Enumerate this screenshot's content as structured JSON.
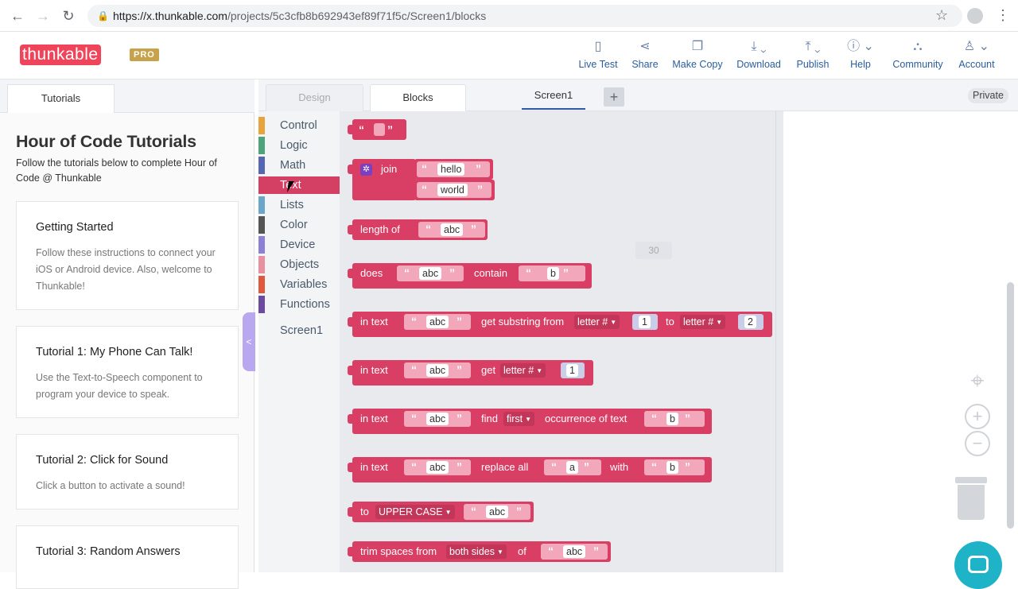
{
  "browser": {
    "url_host": "https://x.thunkable.com",
    "url_path": "/projects/5c3cfb8b692943ef89f71f5c/Screen1/blocks"
  },
  "header": {
    "logo": "thunkable",
    "pro": "PRO",
    "buttons": [
      {
        "label": "Live Test",
        "icon": "phone-icon"
      },
      {
        "label": "Share",
        "icon": "share-icon"
      },
      {
        "label": "Make Copy",
        "icon": "copy-icon"
      },
      {
        "label": "Download",
        "icon": "download-icon"
      },
      {
        "label": "Publish",
        "icon": "publish-icon"
      },
      {
        "label": "Help",
        "icon": "help-icon"
      },
      {
        "label": "Community",
        "icon": "community-icon"
      },
      {
        "label": "Account",
        "icon": "account-icon"
      }
    ]
  },
  "left": {
    "tab": "Tutorials",
    "title": "Hour of Code Tutorials",
    "subtitle": "Follow the tutorials below to complete Hour of Code @ Thunkable",
    "cards": [
      {
        "title": "Getting Started",
        "desc": "Follow these instructions to connect your iOS or Android device. Also, welcome to Thunkable!"
      },
      {
        "title": "Tutorial 1: My Phone Can Talk!",
        "desc": "Use the Text-to-Speech component to program your device to speak."
      },
      {
        "title": "Tutorial 2: Click for Sound",
        "desc": "Click a button to activate a sound!"
      },
      {
        "title": "Tutorial 3: Random Answers",
        "desc": ""
      }
    ]
  },
  "editor": {
    "tabs": {
      "design": "Design",
      "blocks": "Blocks",
      "screen": "Screen1",
      "add": "+",
      "private": "Private"
    },
    "categories": [
      {
        "name": "Control",
        "color": "#e8a33d"
      },
      {
        "name": "Logic",
        "color": "#4fa37a"
      },
      {
        "name": "Math",
        "color": "#5566b3"
      },
      {
        "name": "Text",
        "color": "#d43f64"
      },
      {
        "name": "Lists",
        "color": "#6aa6c7"
      },
      {
        "name": "Color",
        "color": "#555555"
      },
      {
        "name": "Device",
        "color": "#8c7fd6"
      },
      {
        "name": "Objects",
        "color": "#e88fa0"
      },
      {
        "name": "Variables",
        "color": "#e2583e"
      },
      {
        "name": "Functions",
        "color": "#6c4aa0"
      },
      {
        "name": "Screen1",
        "color": ""
      }
    ],
    "ghost_value": "30",
    "blocks": {
      "join": "join",
      "hello": "hello",
      "world": "world",
      "length_of": "length of",
      "abc": "abc",
      "does": "does",
      "contain": "contain",
      "b": "b",
      "in_text": "in text",
      "get_substring_from": "get substring from",
      "letter_num": "letter #",
      "one": "1",
      "two": "2",
      "to": "to",
      "get": "get",
      "find": "find",
      "first": "first",
      "occurrence_of_text": "occurrence of text",
      "replace_all": "replace all",
      "a": "a",
      "with": "with",
      "to_label": "to",
      "upper_case": "UPPER CASE",
      "trim_spaces_from": "trim spaces from",
      "both_sides": "both sides",
      "of": "of"
    }
  }
}
